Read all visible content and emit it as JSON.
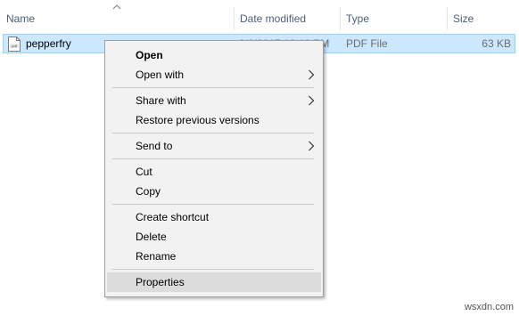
{
  "columns": {
    "name": "Name",
    "date_modified": "Date modified",
    "type": "Type",
    "size": "Size"
  },
  "file": {
    "name": "pepperfry",
    "date_modified": "2/6/2017 12:18 PM",
    "type": "PDF File",
    "size": "63 KB",
    "icon": "pdf-file-icon"
  },
  "context_menu": {
    "items": [
      {
        "label": "Open",
        "bold": true
      },
      {
        "label": "Open with",
        "submenu": true
      },
      {
        "label": "Share with",
        "submenu": true
      },
      {
        "label": "Restore previous versions"
      },
      {
        "label": "Send to",
        "submenu": true
      },
      {
        "label": "Cut"
      },
      {
        "label": "Copy"
      },
      {
        "label": "Create shortcut"
      },
      {
        "label": "Delete"
      },
      {
        "label": "Rename"
      },
      {
        "label": "Properties",
        "highlighted": true
      }
    ]
  },
  "watermark": "wsxdn.com",
  "colors": {
    "selection_bg": "#cce8ff",
    "selection_border": "#99d1ff",
    "menu_bg": "#f2f2f2",
    "menu_hover": "#dcdcdc",
    "header_text": "#4c607a"
  }
}
